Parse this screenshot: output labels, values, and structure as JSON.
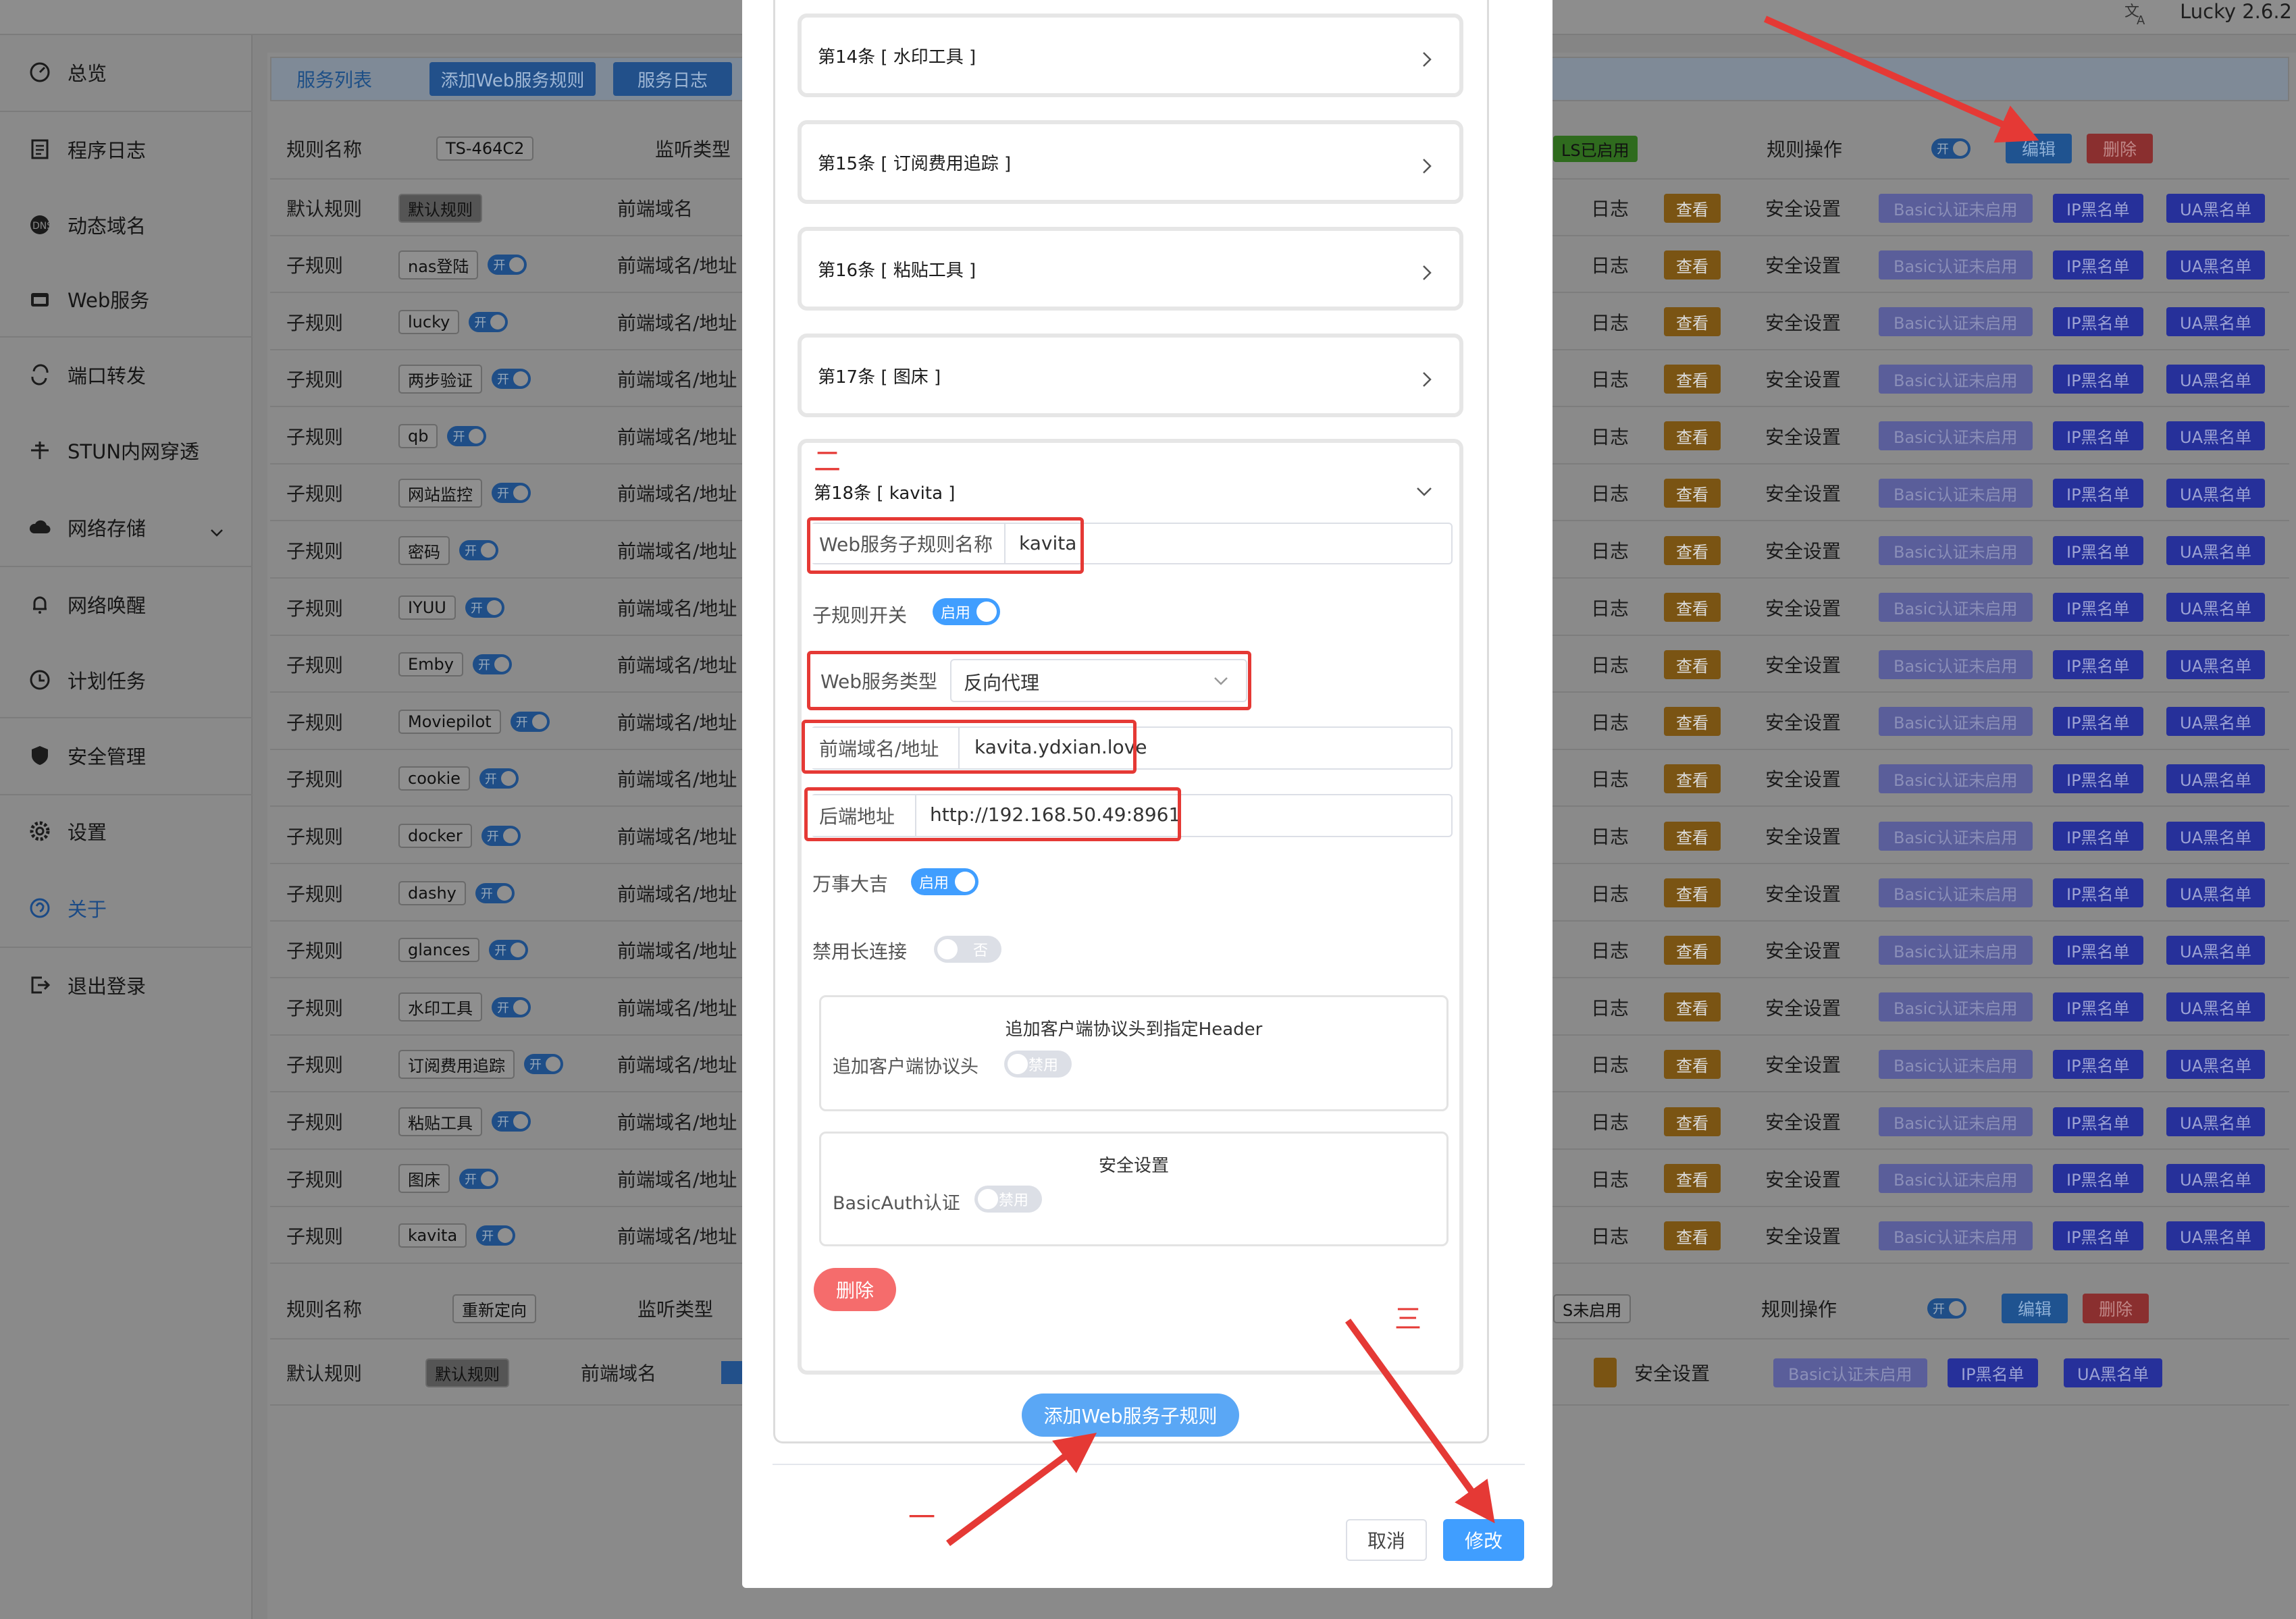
{
  "header": {
    "version": "Lucky 2.6.2",
    "translate_icon": "translate-icon"
  },
  "sidebar": {
    "items": [
      {
        "label": "总览",
        "icon": "dashboard-icon"
      },
      {
        "label": "程序日志",
        "icon": "log-icon"
      },
      {
        "label": "动态域名",
        "icon": "ddns-icon"
      },
      {
        "label": "Web服务",
        "icon": "web-icon"
      },
      {
        "label": "端口转发",
        "icon": "port-icon"
      },
      {
        "label": "STUN内网穿透",
        "icon": "stun-icon"
      },
      {
        "label": "网络存储",
        "icon": "cloud-icon"
      },
      {
        "label": "网络唤醒",
        "icon": "bell-icon"
      },
      {
        "label": "计划任务",
        "icon": "clock-icon"
      },
      {
        "label": "安全管理",
        "icon": "shield-icon"
      },
      {
        "label": "设置",
        "icon": "gear-icon"
      },
      {
        "label": "关于",
        "icon": "about-icon"
      },
      {
        "label": "退出登录",
        "icon": "logout-icon"
      }
    ]
  },
  "tabs": {
    "services": "服务列表",
    "add_rule": "添加Web服务规则",
    "log": "服务日志"
  },
  "rule1": {
    "name_label": "规则名称",
    "name": "TS-464C2",
    "listen_type_label": "监听类型",
    "tls_badge": "LS已启用",
    "ops_label": "规则操作",
    "switch": "开",
    "edit": "编辑",
    "delete": "删除",
    "default_label": "默认规则",
    "default_tag": "默认规则",
    "frontend_label": "前端域名"
  },
  "table": {
    "row_type": "子规则",
    "frontend": "前端域名/地址",
    "log": "日志",
    "view": "查看",
    "security": "安全设置",
    "basic": "Basic认证未启用",
    "ip": "IP黑名单",
    "ua": "UA黑名单",
    "switch": "开",
    "names": [
      "nas登陆",
      "lucky",
      "两步验证",
      "qb",
      "网站监控",
      "密码",
      "IYUU",
      "Emby",
      "Moviepilot",
      "cookie",
      "docker",
      "dashy",
      "glances",
      "水印工具",
      "订阅费用追踪",
      "粘贴工具",
      "图床",
      "kavita"
    ]
  },
  "rule2": {
    "name_label": "规则名称",
    "name": "重新定向",
    "listen_type_label": "监听类型",
    "tls_badge": "S未启用",
    "ops_label": "规则操作",
    "switch": "开",
    "edit": "编辑",
    "delete": "删除",
    "default_label": "默认规则",
    "default_tag": "默认规则",
    "frontend_label": "前端域名",
    "security": "安全设置",
    "basic": "Basic认证未启用",
    "ip": "IP黑名单",
    "ua": "UA黑名单"
  },
  "modal": {
    "collapsed": [
      "第14条 [ 水印工具 ]",
      "第15条 [ 订阅费用追踪 ]",
      "第16条 [ 粘贴工具 ]",
      "第17条 [ 图床 ]"
    ],
    "open_title": "第18条 [ kavita ]",
    "subname_label": "Web服务子规则名称",
    "subname_value": "kavita",
    "switch_label": "子规则开关",
    "switch_value": "启用",
    "type_label": "Web服务类型",
    "type_value": "反向代理",
    "frontend_label": "前端域名/地址",
    "frontend_value": "kavita.ydxian.love",
    "backend_label": "后端地址",
    "backend_value": "http://192.168.50.49:8961",
    "lucky_label": "万事大吉",
    "lucky_value": "启用",
    "keepalive_label": "禁用长连接",
    "keepalive_value": "否",
    "header_title": "追加客户端协议头到指定Header",
    "header_label": "追加客户端协议头",
    "header_value": "禁用",
    "security_title": "安全设置",
    "basic_label": "BasicAuth认证",
    "basic_value": "禁用",
    "delete": "删除",
    "add_sub": "添加Web服务子规则",
    "cancel": "取消",
    "submit": "修改",
    "annot_two": "二",
    "annot_three": "三",
    "annot_one": "一"
  }
}
